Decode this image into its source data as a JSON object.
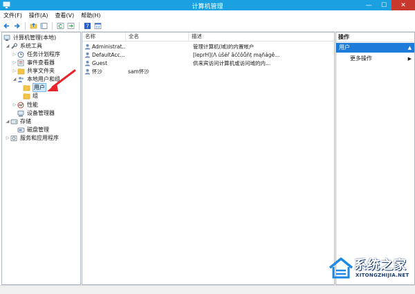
{
  "window": {
    "title": "计算机管理",
    "minimize": "—",
    "maximize": "☐",
    "close": "✕"
  },
  "menu": [
    "文件(F)",
    "操作(A)",
    "查看(V)",
    "帮助(H)"
  ],
  "tree": {
    "root": "计算机管理(本地)",
    "system_tools": "系统工具",
    "task_scheduler": "任务计划程序",
    "event_viewer": "事件查看器",
    "shared_folders": "共享文件夹",
    "local_users": "本地用户和组",
    "users": "用户",
    "groups": "组",
    "performance": "性能",
    "device_manager": "设备管理器",
    "storage": "存储",
    "disk_management": "磁盘管理",
    "services": "服务和应用程序"
  },
  "list": {
    "headers": {
      "name": "名称",
      "fullname": "全名",
      "desc": "描述"
    },
    "rows": [
      {
        "name": "Administrat...",
        "fullname": "",
        "desc": "管理计算机(域)的内置帐户"
      },
      {
        "name": "DefaultAcc...",
        "fullname": "",
        "desc": "[leprH](Λ ùšéř âćčôůňț mąñágê..."
      },
      {
        "name": "Guest",
        "fullname": "",
        "desc": "供来宾访问计算机或访问域的内..."
      },
      {
        "name": "怀沙",
        "fullname": "sam怀沙",
        "desc": ""
      }
    ]
  },
  "actions": {
    "title": "操作",
    "section": "用户",
    "more": "更多操作",
    "section_caret": "▲",
    "more_caret": "▶"
  },
  "watermark": {
    "brand": "系统之家",
    "url": "XITONGZHIJIA.NET"
  },
  "colors": {
    "titlebar": "#1ba1e2",
    "selection": "#1f7bd8",
    "arrow": "#e8232a"
  },
  "icons": [
    "back-icon",
    "forward-icon",
    "up-icon",
    "console-tree-icon",
    "refresh-icon",
    "export-icon",
    "help-icon",
    "mmc-icon"
  ]
}
